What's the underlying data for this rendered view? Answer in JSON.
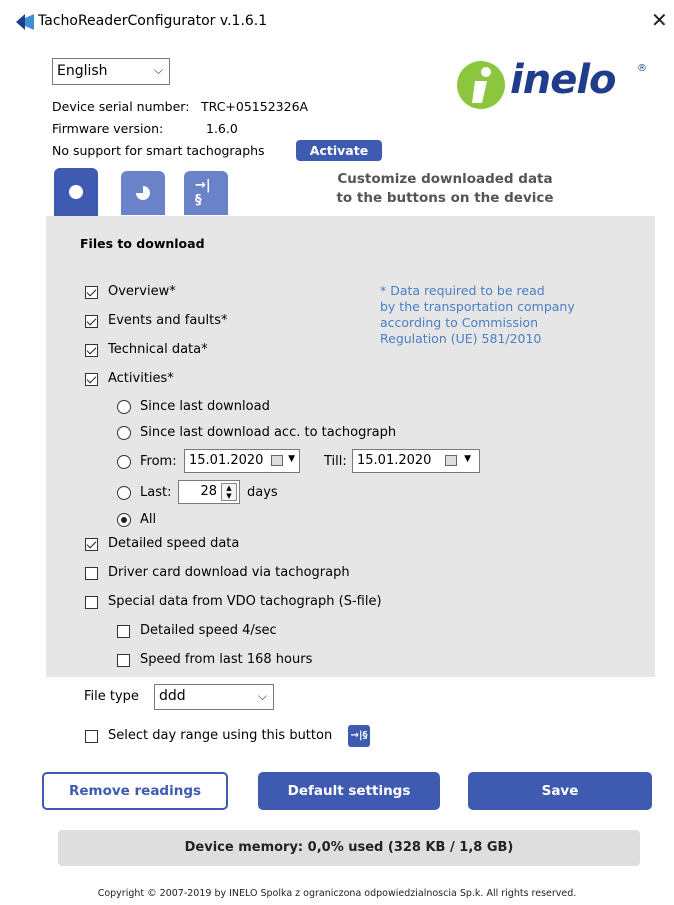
{
  "window": {
    "title": "TachoReaderConfigurator v.1.6.1",
    "close_symbol": "✕"
  },
  "language_select": {
    "value": "English"
  },
  "brand": {
    "logo_text": "inelo",
    "registered": "®"
  },
  "device": {
    "serial_label": "Device serial number:",
    "serial_value": "TRC+05152326A",
    "firmware_label": "Firmware version:",
    "firmware_value": "1.6.0",
    "smart_note": "No support for smart tachographs",
    "activate_label": "Activate"
  },
  "tabs": [
    {
      "icon": "circle-icon",
      "active": true
    },
    {
      "icon": "pie-icon",
      "active": false
    },
    {
      "icon": "arrow-paragraph-icon",
      "active": false,
      "text": "→|§"
    }
  ],
  "customize_text": [
    "Customize downloaded data",
    "to the buttons on the device"
  ],
  "files": {
    "title": "Files to download",
    "overview": {
      "label": "Overview*",
      "checked": true
    },
    "events": {
      "label": "Events and faults*",
      "checked": true
    },
    "technical": {
      "label": "Technical data*",
      "checked": true
    },
    "activities": {
      "label": "Activities*",
      "checked": true
    },
    "note_lines": [
      "* Data required to be read",
      "by the transportation company",
      "according to Commission",
      "Regulation (UE) 581/2010"
    ],
    "activity_options": {
      "since_last": "Since last download",
      "since_last_tacho": "Since last download acc. to tachograph",
      "from_label": "From:",
      "from_value": "15.01.2020",
      "till_label": "Till:",
      "till_value": "15.01.2020",
      "last_label": "Last:",
      "last_value": "28",
      "days_label": "days",
      "all_label": "All",
      "selected": "All"
    },
    "detailed_speed": {
      "label": "Detailed speed data",
      "checked": true
    },
    "driver_card": {
      "label": "Driver card download via tachograph",
      "checked": false
    },
    "special_data": {
      "label": "Special data from VDO tachograph (S-file)",
      "checked": false
    },
    "speed_4sec": {
      "label": "Detailed speed 4/sec",
      "checked": false
    },
    "speed_168": {
      "label": "Speed from last 168 hours",
      "checked": false
    }
  },
  "file_type": {
    "label": "File type",
    "value": "ddd"
  },
  "day_range": {
    "label": "Select day range using this button",
    "icon_text": "→|§",
    "checked": false
  },
  "buttons": {
    "remove": "Remove readings",
    "defaults": "Default settings",
    "save": "Save"
  },
  "memory_text": "Device memory: 0,0% used (328 KB / 1,8 GB)",
  "copyright": "Copyright © 2007-2019 by INELO Spolka z ograniczona odpowiedzialnoscia Sp.k. All rights reserved.",
  "colors": {
    "accent": "#3f5bb1",
    "tab_inactive": "#6a82c8",
    "panel": "#e6e6e6",
    "note": "#4a7fc6",
    "logo_green": "#8cc63f",
    "logo_blue": "#1f3d8a"
  }
}
